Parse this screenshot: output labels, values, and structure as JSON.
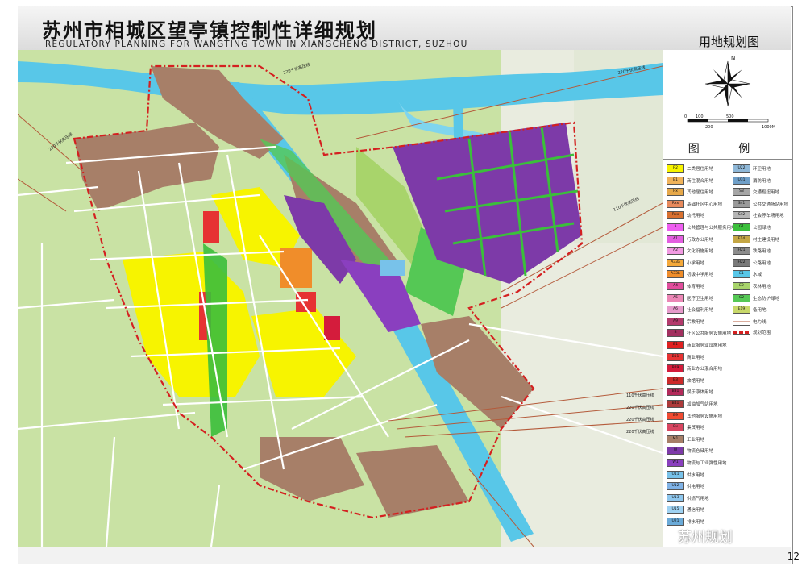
{
  "header": {
    "title_cn": "苏州市相城区望亭镇控制性详细规划",
    "title_en": "REGULATORY PLANNING FOR WANGTING TOWN IN XIANGCHENG DISTRICT, SUZHOU",
    "sheet_title": "用地规划图"
  },
  "compass": {
    "north": "N"
  },
  "scale_bar": {
    "labels": [
      "0",
      "100",
      "500",
      "200",
      "1000M"
    ]
  },
  "legend": {
    "title": "图 例",
    "left": [
      {
        "code": "R2",
        "label": "二类居住用地",
        "color": "#f7f400"
      },
      {
        "code": "B1",
        "label": "商住混合用地",
        "color": "#f0b35a"
      },
      {
        "code": "Rx",
        "label": "其他居住用地",
        "color": "#e6a84a"
      },
      {
        "code": "Rxx",
        "label": "基础社区中心用地",
        "color": "#e88a5c"
      },
      {
        "code": "Rxx",
        "label": "幼托用地",
        "color": "#d9702f"
      },
      {
        "code": "A",
        "label": "公共管理与公共服务用地",
        "color": "#ee5ef0"
      },
      {
        "code": "A1",
        "label": "行政办公用地",
        "color": "#e35fe0"
      },
      {
        "code": "A2",
        "label": "文化设施用地",
        "color": "#f29ae2"
      },
      {
        "code": "A33a",
        "label": "小学用地",
        "color": "#f5a93a"
      },
      {
        "code": "A33b",
        "label": "初级中学用地",
        "color": "#f08d2a"
      },
      {
        "code": "A4",
        "label": "体育用地",
        "color": "#e04d9c"
      },
      {
        "code": "A5",
        "label": "医疗卫生用地",
        "color": "#ec87b6"
      },
      {
        "code": "A6",
        "label": "社会福利用地",
        "color": "#e79acb"
      },
      {
        "code": "A9",
        "label": "宗教用地",
        "color": "#b33a6c"
      },
      {
        "code": "B",
        "label": "社区公共服务设施用地",
        "color": "#a33060"
      },
      {
        "code": "B1",
        "label": "商业服务业设施用地",
        "color": "#e02020"
      },
      {
        "code": "B11",
        "label": "商业用地",
        "color": "#e63232"
      },
      {
        "code": "B29",
        "label": "商业办公混合用地",
        "color": "#d41c3c"
      },
      {
        "code": "B3",
        "label": "旅馆用地",
        "color": "#cc2a2a"
      },
      {
        "code": "B31",
        "label": "娱乐康体用地",
        "color": "#b32a5a"
      },
      {
        "code": "B41",
        "label": "加油加气站用地",
        "color": "#ad3a3a"
      },
      {
        "code": "B9",
        "label": "其他服务设施用地",
        "color": "#f04a30"
      },
      {
        "code": "Bx",
        "label": "集贸用地",
        "color": "#d84560"
      },
      {
        "code": "M1",
        "label": "工业用地",
        "color": "#a77f68"
      },
      {
        "code": "W",
        "label": "物流仓储用地",
        "color": "#7d3aa8"
      },
      {
        "code": "W1",
        "label": "物流与工业弹性用地",
        "color": "#8a3fbf"
      },
      {
        "code": "U11",
        "label": "供水用地",
        "color": "#78c2ea"
      },
      {
        "code": "U12",
        "label": "供电用地",
        "color": "#7fb2e6"
      },
      {
        "code": "U13",
        "label": "供燃气用地",
        "color": "#8ec7ee"
      },
      {
        "code": "U15",
        "label": "通信用地",
        "color": "#9fd2f2"
      },
      {
        "code": "U21",
        "label": "排水用地",
        "color": "#6aaad8"
      }
    ],
    "right": [
      {
        "code": "U22",
        "label": "环卫用地",
        "color": "#8fb8d8"
      },
      {
        "code": "U31",
        "label": "消防用地",
        "color": "#6f9fc8"
      },
      {
        "code": "S3",
        "label": "交通枢纽用地",
        "color": "#a6a6a6"
      },
      {
        "code": "S41",
        "label": "公共交通场站用地",
        "color": "#9a9a9a"
      },
      {
        "code": "S42",
        "label": "社会停车场用地",
        "color": "#b5b5b5"
      },
      {
        "code": "G1",
        "label": "公园绿地",
        "color": "#3bbf3b"
      },
      {
        "code": "E14",
        "label": "村庄建设用地",
        "color": "#c4a644"
      },
      {
        "code": "H21",
        "label": "铁路用地",
        "color": "#8c8c8c"
      },
      {
        "code": "H22",
        "label": "公路用地",
        "color": "#7a7a7a"
      },
      {
        "code": "E1",
        "label": "水域",
        "color": "#58c7e8"
      },
      {
        "code": "E2",
        "label": "农林用地",
        "color": "#a8d46b"
      },
      {
        "code": "G2",
        "label": "生态防护绿地",
        "color": "#55c855"
      },
      {
        "code": "E19",
        "label": "备用地",
        "color": "#c8d86a"
      },
      {
        "code": "",
        "label": "电力线",
        "color": "#ffffff"
      },
      {
        "code": "",
        "label": "规划范围",
        "color": "#ffffff"
      }
    ]
  },
  "map": {
    "labels": {
      "road_220_top": "220千伏高压线",
      "road_220_top2": "220千伏高压线",
      "road_220_left": "220千伏高压线",
      "road_110_right": "110千伏高压线",
      "road_110_low": "110千伏高压线",
      "road_220_low1": "220千伏高压线",
      "road_220_low2": "220千伏高压线",
      "road_220_low3": "220千伏高压线"
    }
  },
  "footer": {
    "page_number": "12",
    "watermark": "苏州规划"
  },
  "colors": {
    "water": "#58c7e8",
    "farmland": "#c9e2a4",
    "industrial": "#a77f68",
    "residential": "#f7f400",
    "logistics": "#7d3aa8",
    "green": "#3bbf3b",
    "boundary": "#d42020"
  }
}
